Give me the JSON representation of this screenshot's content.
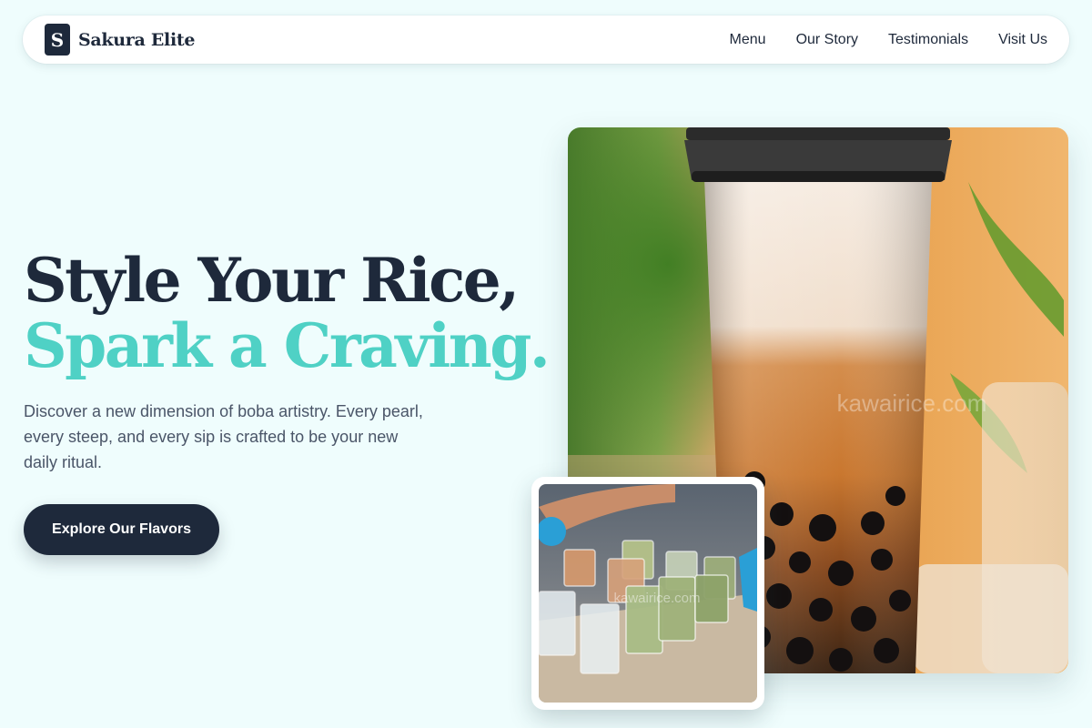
{
  "nav": {
    "brand_initial": "S",
    "brand_name": "Sakura Elite",
    "links": [
      "Menu",
      "Our Story",
      "Testimonials",
      "Visit Us"
    ]
  },
  "hero": {
    "title_line1": "Style Your Rice,",
    "title_line2": "Spark a Craving.",
    "description": "Discover a new dimension of boba artistry. Every pearl, every steep, and every sip is crafted to be your new daily ritual.",
    "cta_label": "Explore Our Flavors"
  },
  "images": {
    "main_watermark": "kawairice.com",
    "inset_watermark": "kawairice.com"
  },
  "colors": {
    "background": "#effdfd",
    "primary": "#1e293b",
    "accent": "#4fd1c5",
    "body_text": "#4a5568"
  }
}
